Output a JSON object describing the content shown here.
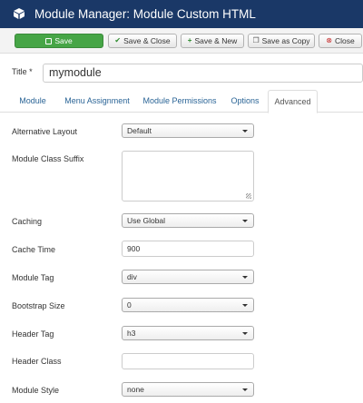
{
  "header": {
    "title": "Module Manager: Module Custom HTML",
    "icon": "cube-icon"
  },
  "toolbar": {
    "save_label": "Save",
    "save_close_label": "Save & Close",
    "save_new_label": "Save & New",
    "save_copy_label": "Save as Copy",
    "close_label": "Close",
    "colors": {
      "save_bg": "#46a546",
      "header_bg": "#1a3867"
    }
  },
  "title_field": {
    "label": "Title *",
    "value": "mymodule"
  },
  "tabs": [
    {
      "label": "Module"
    },
    {
      "label": "Menu Assignment"
    },
    {
      "label": "Module Permissions"
    },
    {
      "label": "Options"
    },
    {
      "label": "Advanced",
      "active": true
    }
  ],
  "form": {
    "alternative_layout": {
      "label": "Alternative Layout",
      "value": "Default"
    },
    "module_class_suffix": {
      "label": "Module Class Suffix",
      "value": ""
    },
    "caching": {
      "label": "Caching",
      "value": "Use Global"
    },
    "cache_time": {
      "label": "Cache Time",
      "value": "900"
    },
    "module_tag": {
      "label": "Module Tag",
      "value": "div"
    },
    "bootstrap_size": {
      "label": "Bootstrap Size",
      "value": "0"
    },
    "header_tag": {
      "label": "Header Tag",
      "value": "h3"
    },
    "header_class": {
      "label": "Header Class",
      "value": ""
    },
    "module_style": {
      "label": "Module Style",
      "value": "none"
    }
  }
}
